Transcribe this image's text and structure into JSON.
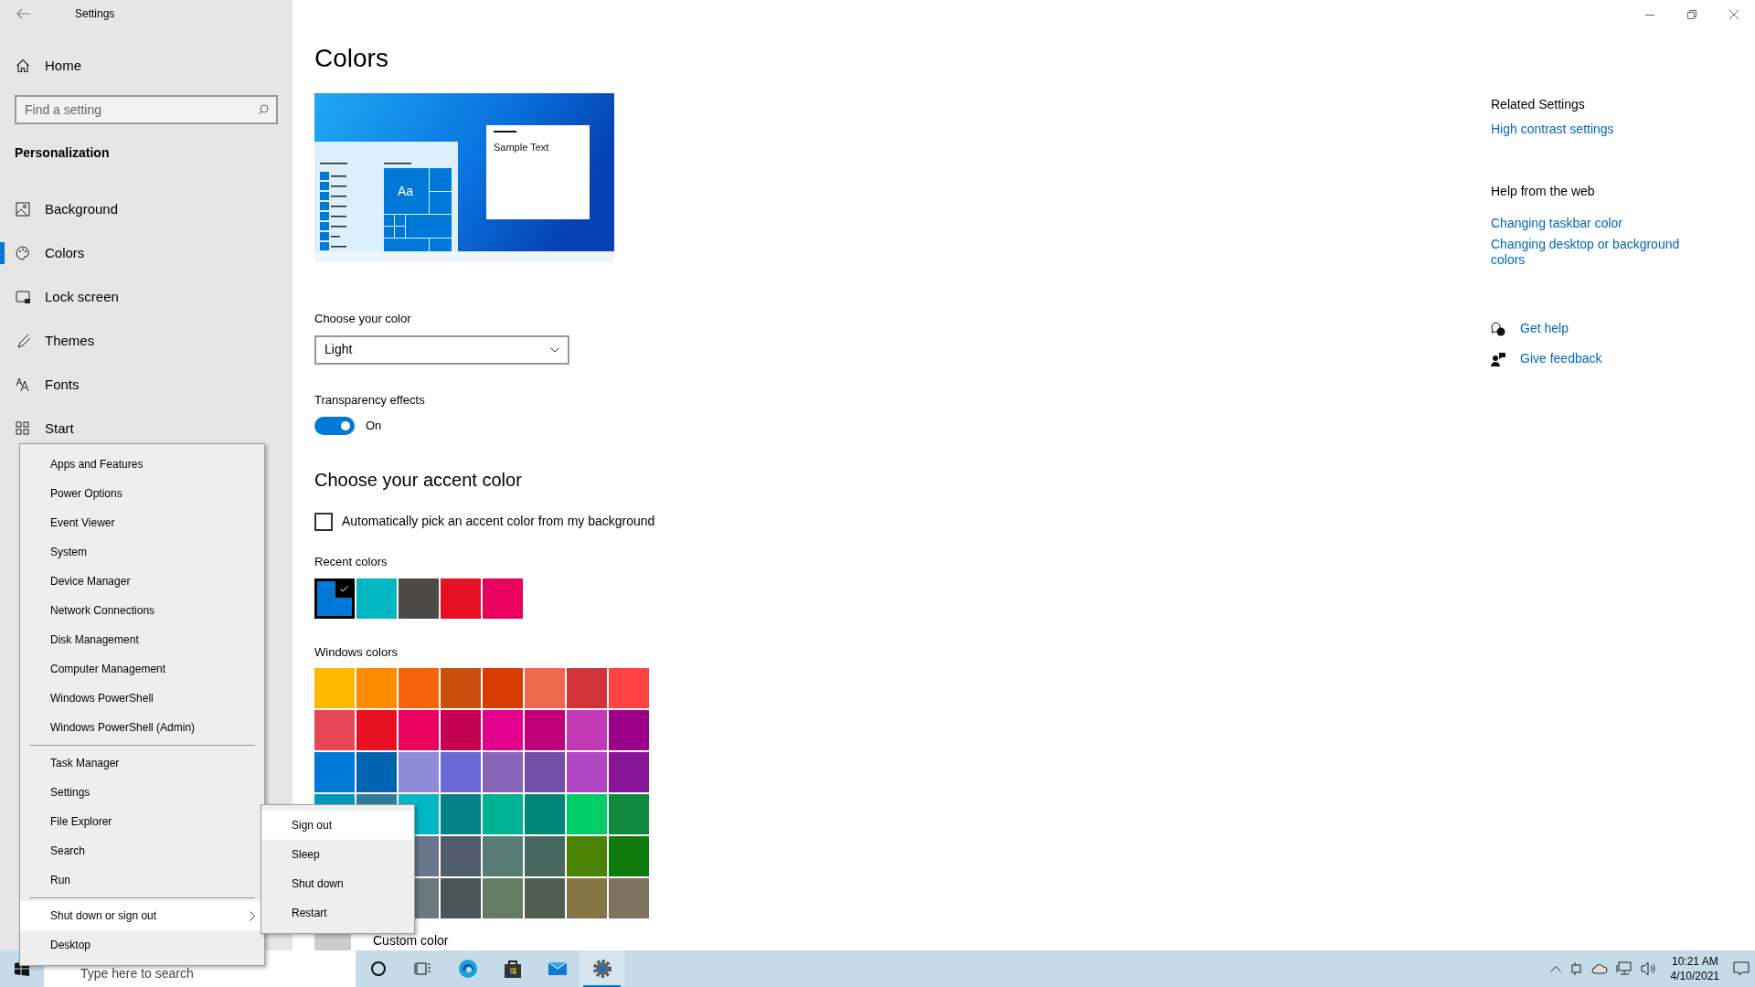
{
  "window": {
    "title": "Settings"
  },
  "sidebar": {
    "home": "Home",
    "search": {
      "placeholder": "Find a setting"
    },
    "section": "Personalization",
    "items": [
      {
        "kind": "background",
        "label": "Background",
        "selected": false
      },
      {
        "kind": "colors",
        "label": "Colors",
        "selected": true
      },
      {
        "kind": "lock",
        "label": "Lock screen",
        "selected": false
      },
      {
        "kind": "themes",
        "label": "Themes",
        "selected": false
      },
      {
        "kind": "fonts",
        "label": "Fonts",
        "selected": false
      },
      {
        "kind": "start",
        "label": "Start",
        "selected": false
      }
    ]
  },
  "page": {
    "title": "Colors",
    "preview": {
      "tile_label": "Aa",
      "sample_text": "Sample Text"
    },
    "choose_color": {
      "label": "Choose your color",
      "value": "Light"
    },
    "transparency": {
      "label": "Transparency effects",
      "on": true,
      "state_text": "On"
    },
    "accent_heading": "Choose your accent color",
    "auto_pick": {
      "label": "Automatically pick an accent color from my background",
      "checked": false
    },
    "recent": {
      "label": "Recent colors",
      "colors": [
        {
          "color": "#0078d7",
          "selected": true
        },
        {
          "color": "#00b7c3",
          "selected": false
        },
        {
          "color": "#4c4a48",
          "selected": false
        },
        {
          "color": "#e81123",
          "selected": false
        },
        {
          "color": "#ea005e",
          "selected": false
        }
      ]
    },
    "windows_colors": {
      "label": "Windows colors",
      "rows": [
        [
          {
            "color": "#ffb900"
          },
          {
            "color": "#ff8c00"
          },
          {
            "color": "#f7630c"
          },
          {
            "color": "#ca5010"
          },
          {
            "color": "#da3b01"
          },
          {
            "color": "#ef6950"
          },
          {
            "color": "#d13438"
          },
          {
            "color": "#ff4343"
          }
        ],
        [
          {
            "color": "#e74856"
          },
          {
            "color": "#e81123"
          },
          {
            "color": "#ea005e"
          },
          {
            "color": "#c30052"
          },
          {
            "color": "#e3008c"
          },
          {
            "color": "#bf0077"
          },
          {
            "color": "#c239b3"
          },
          {
            "color": "#9a0089"
          }
        ],
        [
          {
            "color": "#0078d7"
          },
          {
            "color": "#0063b1"
          },
          {
            "color": "#8e8cd8"
          },
          {
            "color": "#6b69d6"
          },
          {
            "color": "#8764b8"
          },
          {
            "color": "#744da9"
          },
          {
            "color": "#b146c2"
          },
          {
            "color": "#881798"
          }
        ],
        [
          {
            "color": "#0099bc"
          },
          {
            "color": "#2d7d9a"
          },
          {
            "color": "#00b7c3"
          },
          {
            "color": "#038387"
          },
          {
            "color": "#00b294"
          },
          {
            "color": "#018574"
          },
          {
            "color": "#00cc6a"
          },
          {
            "color": "#10893e"
          }
        ],
        [
          {
            "color": "#68768a"
          },
          {
            "color": "#515c6b"
          },
          {
            "color": "#567c73"
          },
          {
            "color": "#486860"
          },
          {
            "color": "#498205"
          },
          {
            "color": "#107c10"
          }
        ],
        [
          {
            "color": "#69797e"
          },
          {
            "color": "#4a5459"
          },
          {
            "color": "#647c64"
          },
          {
            "color": "#525e54"
          },
          {
            "color": "#847545"
          },
          {
            "color": "#7e735f"
          }
        ]
      ]
    },
    "custom_color": "Custom color"
  },
  "related": {
    "heading": "Related Settings",
    "links": [
      "High contrast settings"
    ],
    "help_heading": "Help from the web",
    "help_links": [
      "Changing taskbar color",
      "Changing desktop or background colors"
    ],
    "actions": [
      {
        "kind": "help",
        "label": "Get help"
      },
      {
        "kind": "feedback",
        "label": "Give feedback"
      }
    ]
  },
  "context_menu": {
    "groups": [
      [
        {
          "label": "Apps and Features",
          "selected": false,
          "submenu": false
        },
        {
          "label": "Power Options",
          "selected": false,
          "submenu": false
        },
        {
          "label": "Event Viewer",
          "selected": false,
          "submenu": false
        },
        {
          "label": "System",
          "selected": false,
          "submenu": false
        },
        {
          "label": "Device Manager",
          "selected": false,
          "submenu": false
        },
        {
          "label": "Network Connections",
          "selected": false,
          "submenu": false
        },
        {
          "label": "Disk Management",
          "selected": false,
          "submenu": false
        },
        {
          "label": "Computer Management",
          "selected": false,
          "submenu": false
        },
        {
          "label": "Windows PowerShell",
          "selected": false,
          "submenu": false
        },
        {
          "label": "Windows PowerShell (Admin)",
          "selected": false,
          "submenu": false
        }
      ],
      [
        {
          "label": "Task Manager",
          "selected": false,
          "submenu": false
        },
        {
          "label": "Settings",
          "selected": false,
          "submenu": false
        },
        {
          "label": "File Explorer",
          "selected": false,
          "submenu": false
        },
        {
          "label": "Search",
          "selected": false,
          "submenu": false
        },
        {
          "label": "Run",
          "selected": false,
          "submenu": false
        }
      ],
      [
        {
          "label": "Shut down or sign out",
          "selected": true,
          "submenu": true
        },
        {
          "label": "Desktop",
          "selected": false,
          "submenu": false
        }
      ]
    ]
  },
  "submenu": [
    {
      "label": "Sign out",
      "selected": true
    },
    {
      "label": "Sleep",
      "selected": false
    },
    {
      "label": "Shut down",
      "selected": false
    },
    {
      "label": "Restart",
      "selected": false
    }
  ],
  "taskbar": {
    "search_placeholder": "Type here to search",
    "apps": [
      {
        "kind": "cortana",
        "active": false
      },
      {
        "kind": "taskview",
        "active": false
      },
      {
        "kind": "edge",
        "active": false
      },
      {
        "kind": "store",
        "active": false
      },
      {
        "kind": "mail",
        "active": false
      },
      {
        "kind": "settings",
        "active": true
      }
    ],
    "time": "10:21 AM",
    "date": "4/10/2021"
  }
}
